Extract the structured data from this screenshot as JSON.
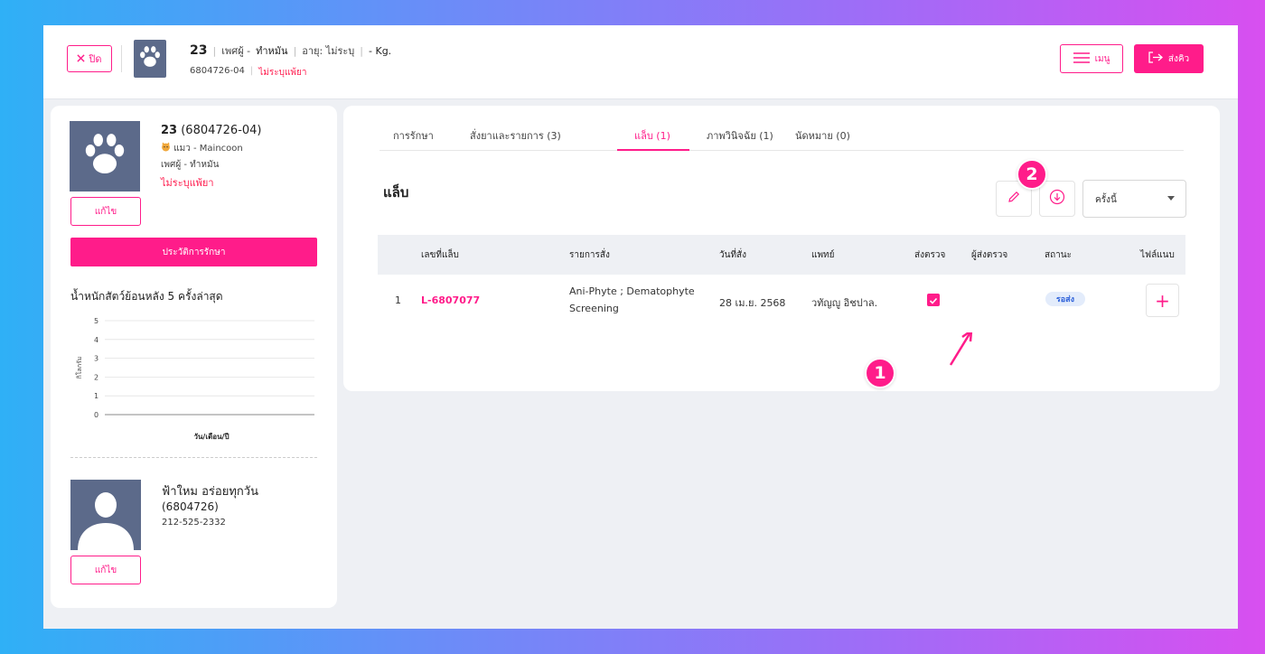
{
  "header": {
    "close_label": "ปิด",
    "pet_number": "23",
    "sex_label": "เพศผู้ -",
    "sterile_label": "ทำหมัน",
    "age_label": "อายุ: ไม่ระบุ",
    "weight_label": "- Kg.",
    "pet_code": "6804726-04",
    "allergy_label": "ไม่ระบุแพ้ยา",
    "menu_label": "เมนู",
    "queue_label": "ส่งคิว"
  },
  "pet": {
    "name": "23",
    "code": "(6804726-04)",
    "breed": "แมว - Maincoon",
    "sex": "เพศผู้ - ทำหมัน",
    "allergy": "ไม่ระบุแพ้ยา",
    "edit_label": "แก้ไข",
    "history_label": "ประวัติการรักษา"
  },
  "weight_chart": {
    "title": "น้ำหนักสัตว์ย้อนหลัง 5 ครั้งล่าสุด"
  },
  "chart_data": {
    "type": "line",
    "title": "น้ำหนักสัตว์ย้อนหลัง 5 ครั้งล่าสุด",
    "xlabel": "วัน/เดือน/ปี",
    "ylabel": "กิโลกรัม",
    "y_ticks": [
      "5",
      "4",
      "3",
      "2",
      "1",
      "0"
    ],
    "ylim": [
      0,
      5
    ],
    "grid": true,
    "series": []
  },
  "owner": {
    "name": "ฟ้าใหม อร่อยทุกวัน",
    "id": "(6804726)",
    "phone": "212-525-2332",
    "edit_label": "แก้ไข"
  },
  "tabs": [
    {
      "label": "การรักษา"
    },
    {
      "label": "สั่งยาและรายการ (3)"
    },
    {
      "label": "แล็บ (1)"
    },
    {
      "label": "ภาพวินิจฉัย (1)"
    },
    {
      "label": "นัดหมาย (0)"
    }
  ],
  "active_tab": "แล็บ (1)",
  "lab_section": {
    "title": "แล็บ",
    "period_select": "ครั้งนี้",
    "edit_icon": "pencil-icon",
    "download_icon": "download-circle-icon"
  },
  "table": {
    "headers": [
      "เลขที่แล็บ",
      "รายการสั่ง",
      "วันที่สั่ง",
      "แพทย์",
      "ส่งตรวจ",
      "ผู้ส่งตรวจ",
      "สถานะ",
      "ไฟล์แนบ"
    ],
    "rows": [
      {
        "index": "1",
        "lab_no": "L-6807077",
        "item_line1": "Ani-Phyte ; Dematophyte",
        "item_line2": "Screening",
        "date": "28 เม.ย. 2568",
        "doctor": "วทัญญู อิชปาล.",
        "sent": true,
        "sender": "",
        "status": "รอส่ง"
      }
    ]
  },
  "markers": [
    {
      "label": "1"
    },
    {
      "label": "2"
    }
  ],
  "colors": {
    "accent": "#ff1c8a",
    "avatar_bg": "#5c6a8a",
    "status_badge_bg": "#e3ecfb",
    "status_badge_text": "#2b5fd9"
  }
}
